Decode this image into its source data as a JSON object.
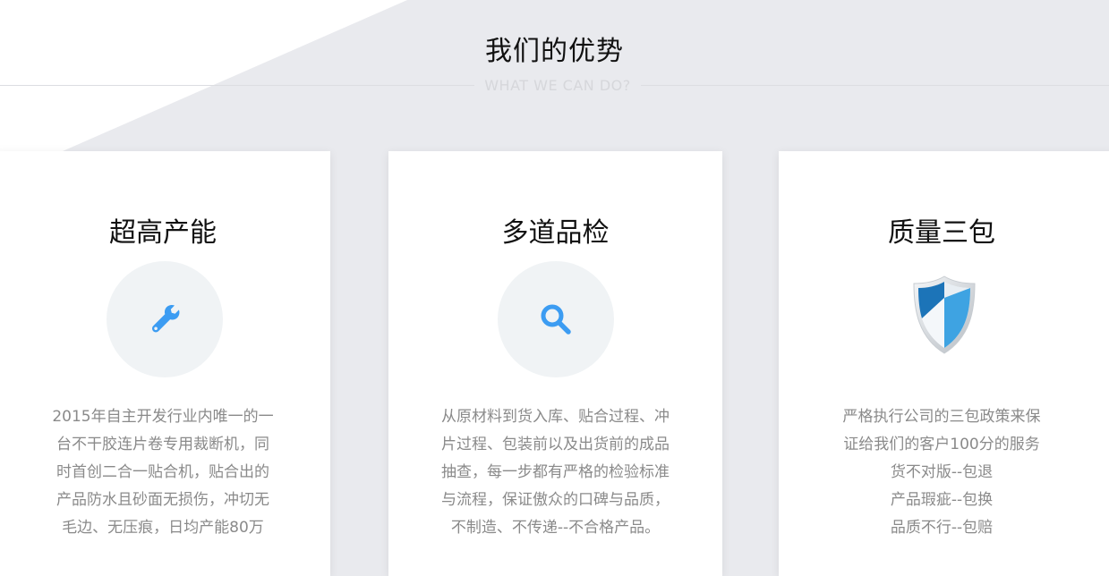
{
  "section": {
    "title": "我们的优势",
    "subtitle": "WHAT WE CAN DO?"
  },
  "cards": [
    {
      "title": "超高产能",
      "icon": "wrench-icon",
      "lines": [
        "2015年自主开发行业内唯一的一",
        "台不干胶连片卷专用裁断机，同",
        "时首创二合一贴合机，贴合出的",
        "产品防水且砂面无损伤，冲切无",
        "毛边、无压痕，日均产能80万"
      ]
    },
    {
      "title": "多道品检",
      "icon": "search-icon",
      "lines": [
        "从原材料到货入库、贴合过程、冲",
        "片过程、包装前以及出货前的成品",
        "抽查，每一步都有严格的检验标准",
        "与流程，保证傲众的口碑与品质，",
        "不制造、不传递--不合格产品。"
      ]
    },
    {
      "title": "质量三包",
      "icon": "shield-icon",
      "lines": [
        "严格执行公司的三包政策来保",
        "证给我们的客户100分的服务",
        "货不对版--包退",
        "产品瑕疵--包换",
        "品质不行--包赔"
      ]
    }
  ],
  "colors": {
    "background_shape": "#e9eaee",
    "icon_blue": "#3c9cf2",
    "text_gray": "#8a8a8a"
  }
}
